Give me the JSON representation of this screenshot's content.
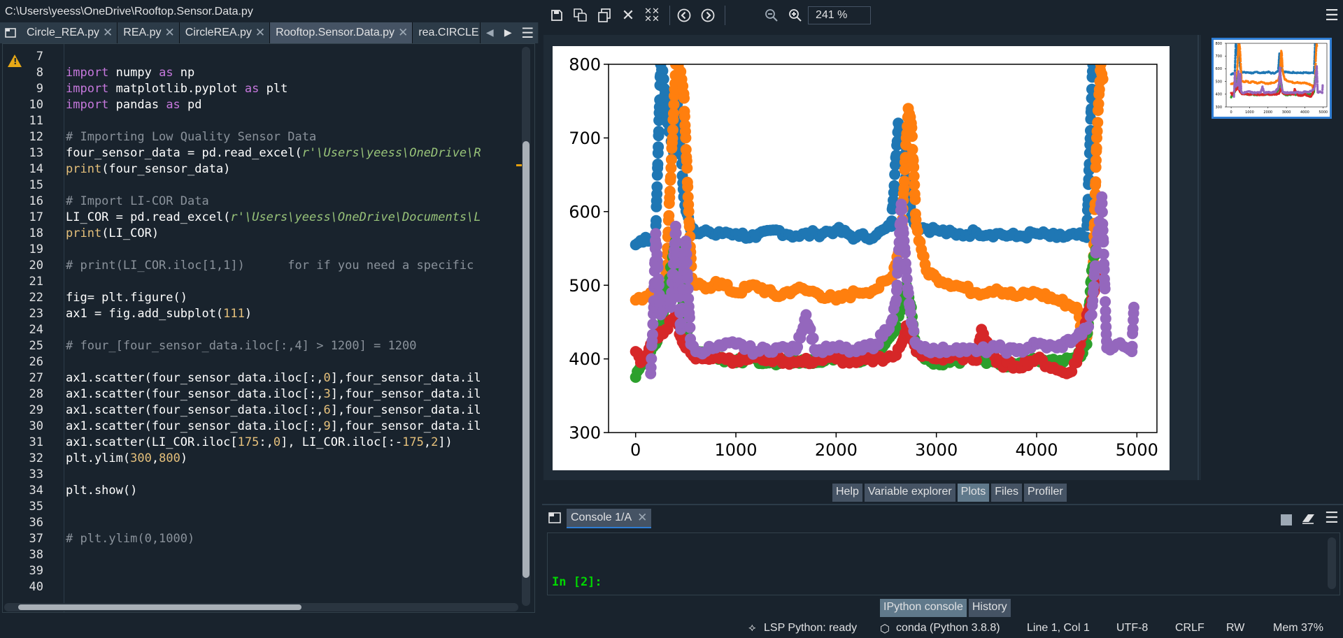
{
  "window": {
    "title": "C:\\Users\\yeess\\OneDrive\\Rooftop.Sensor.Data.py"
  },
  "editor_tabs": [
    {
      "label": "Circle_REA.py",
      "active": false
    },
    {
      "label": "REA.py",
      "active": false
    },
    {
      "label": "CircleREA.py",
      "active": false
    },
    {
      "label": "Rooftop.Sensor.Data.py",
      "active": true
    },
    {
      "label": "rea.CIRCLE.",
      "active": false
    }
  ],
  "editor": {
    "line_numbers": [
      "7",
      "8",
      "9",
      "10",
      "11",
      "12",
      "13",
      "14",
      "15",
      "16",
      "17",
      "18",
      "19",
      "20",
      "21",
      "22",
      "23",
      "24",
      "25",
      "26",
      "27",
      "28",
      "29",
      "30",
      "31",
      "32",
      "33",
      "34",
      "35",
      "36",
      "37",
      "38",
      "39",
      "40"
    ],
    "warning_line": "8",
    "lines": [
      "",
      "import numpy as np",
      "import matplotlib.pyplot as plt",
      "import pandas as pd",
      "",
      "# Importing Low Quality Sensor Data",
      "four_sensor_data = pd.read_excel(r'\\Users\\yeess\\OneDrive\\R",
      "print(four_sensor_data)",
      "",
      "# Import LI-COR Data",
      "LI_COR = pd.read_excel(r'\\Users\\yeess\\OneDrive\\Documents\\L",
      "print(LI_COR)",
      "",
      "# print(LI_COR.iloc[1,1])      for if you need a specific",
      "",
      "fig= plt.figure()",
      "ax1 = fig.add_subplot(111)",
      "",
      "# four_[four_sensor_data.iloc[:,4] > 1200] = 1200",
      "",
      "ax1.scatter(four_sensor_data.iloc[:,0],four_sensor_data.il",
      "ax1.scatter(four_sensor_data.iloc[:,3],four_sensor_data.il",
      "ax1.scatter(four_sensor_data.iloc[:,6],four_sensor_data.il",
      "ax1.scatter(four_sensor_data.iloc[:,9],four_sensor_data.il",
      "ax1.scatter(LI_COR.iloc[175:,0], LI_COR.iloc[:-175,2])",
      "plt.ylim(300,800)",
      "",
      "plt.show()",
      "",
      "",
      "# plt.ylim(0,1000)",
      "",
      "",
      ""
    ]
  },
  "plots_toolbar": {
    "zoom": "241 %"
  },
  "pane_tabs": [
    "Help",
    "Variable explorer",
    "Plots",
    "Files",
    "Profiler"
  ],
  "pane_tabs_active": "Plots",
  "console": {
    "tab_label": "Console 1/A",
    "prompt": "In [2]:",
    "bottom_tabs": [
      "IPython console",
      "History"
    ]
  },
  "statusbar": {
    "lsp": "LSP Python: ready",
    "env": "conda (Python 3.8.8)",
    "position": "Line 1, Col 1",
    "encoding": "UTF-8",
    "eol": "CRLF",
    "perm": "RW",
    "mem": "Mem 37%"
  },
  "chart_data": {
    "type": "scatter",
    "xlabel": "",
    "ylabel": "",
    "xticks": [
      0,
      1000,
      2000,
      3000,
      4000,
      5000
    ],
    "yticks": [
      300,
      400,
      500,
      600,
      700,
      800
    ],
    "xlim": [
      -270,
      5200
    ],
    "ylim": [
      300,
      800
    ],
    "series": [
      {
        "color": "#1f77b4",
        "x": [
          0,
          100,
          150,
          200,
          250,
          280,
          320,
          380,
          420,
          480,
          550,
          600,
          700,
          800,
          900,
          1000,
          1200,
          1400,
          1600,
          1800,
          2000,
          2200,
          2400,
          2550,
          2620,
          2650,
          2680,
          2700,
          2720,
          2760,
          2800,
          3000,
          3200,
          3400,
          3600,
          3800,
          4000,
          4200,
          4400,
          4500,
          4560,
          4600,
          4620
        ],
        "y": [
          555,
          565,
          560,
          570,
          800,
          780,
          720,
          680,
          760,
          620,
          575,
          570,
          575,
          568,
          572,
          570,
          565,
          575,
          567,
          570,
          575,
          565,
          568,
          580,
          720,
          700,
          690,
          640,
          620,
          590,
          580,
          575,
          568,
          572,
          570,
          566,
          570,
          565,
          568,
          565,
          800,
          790,
          780
        ]
      },
      {
        "color": "#ff7f0e",
        "x": [
          0,
          100,
          150,
          200,
          300,
          400,
          450,
          480,
          500,
          530,
          560,
          600,
          700,
          800,
          1000,
          1200,
          1400,
          1600,
          1800,
          2000,
          2200,
          2400,
          2550,
          2650,
          2700,
          2720,
          2750,
          2800,
          2900,
          3000,
          3200,
          3400,
          3600,
          3800,
          4000,
          4200,
          4400,
          4450,
          4500,
          4560,
          4600,
          4640,
          4660
        ],
        "y": [
          480,
          485,
          490,
          495,
          500,
          800,
          790,
          760,
          700,
          600,
          510,
          500,
          495,
          505,
          490,
          500,
          485,
          495,
          490,
          480,
          490,
          495,
          510,
          560,
          700,
          740,
          720,
          580,
          520,
          510,
          500,
          490,
          495,
          485,
          490,
          480,
          470,
          440,
          430,
          500,
          700,
          800,
          780
        ]
      },
      {
        "color": "#2ca02c",
        "x": [
          0,
          50,
          100,
          150,
          200,
          300,
          400,
          450,
          500,
          600,
          800,
          1000,
          1200,
          1400,
          1600,
          1800,
          2000,
          2200,
          2400,
          2600,
          2700,
          2750,
          2800,
          3000,
          3200,
          3400,
          3600,
          3800,
          4000,
          4200,
          4400,
          4500,
          4550,
          4600
        ],
        "y": [
          375,
          390,
          400,
          410,
          420,
          480,
          560,
          520,
          440,
          410,
          405,
          395,
          400,
          392,
          398,
          395,
          405,
          398,
          400,
          440,
          500,
          470,
          410,
          395,
          398,
          400,
          395,
          392,
          398,
          395,
          400,
          420,
          520,
          560
        ]
      },
      {
        "color": "#d62728",
        "x": [
          0,
          50,
          100,
          150,
          200,
          300,
          400,
          450,
          500,
          600,
          800,
          1000,
          1200,
          1400,
          1600,
          1800,
          2000,
          2200,
          2400,
          2600,
          2650,
          2700,
          2800,
          3000,
          3200,
          3400,
          3450,
          3600,
          3800,
          4000,
          4200,
          4300,
          4400,
          4500,
          4550,
          4600
        ],
        "y": [
          410,
          395,
          400,
          420,
          430,
          440,
          460,
          430,
          415,
          400,
          405,
          398,
          402,
          400,
          395,
          398,
          400,
          395,
          400,
          405,
          420,
          445,
          410,
          400,
          405,
          398,
          440,
          395,
          390,
          400,
          385,
          380,
          395,
          460,
          480,
          510
        ]
      },
      {
        "color": "#9467bd",
        "x": [
          150,
          180,
          200,
          250,
          300,
          350,
          400,
          450,
          500,
          550,
          600,
          800,
          1000,
          1200,
          1400,
          1600,
          1700,
          1800,
          2000,
          2200,
          2400,
          2550,
          2600,
          2650,
          2700,
          2750,
          2800,
          3000,
          3200,
          3400,
          3600,
          3800,
          4000,
          4200,
          4400,
          4500,
          4550,
          4600,
          4650,
          4700,
          4800,
          4900,
          4950,
          4970
        ],
        "y": [
          380,
          470,
          570,
          460,
          480,
          470,
          580,
          440,
          560,
          420,
          410,
          415,
          420,
          410,
          415,
          412,
          460,
          410,
          415,
          410,
          420,
          450,
          480,
          610,
          520,
          450,
          420,
          410,
          415,
          410,
          415,
          410,
          420,
          415,
          430,
          440,
          460,
          560,
          620,
          415,
          420,
          415,
          410,
          470
        ]
      }
    ]
  }
}
